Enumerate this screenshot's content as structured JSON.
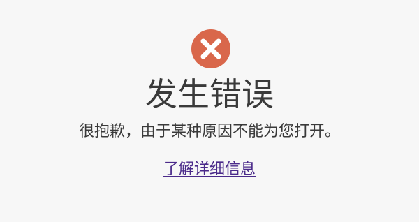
{
  "error": {
    "icon": "error-x-icon",
    "icon_color": "#d9674b",
    "title": "发生错误",
    "message": "很抱歉，由于某种原因不能为您打开。",
    "learn_more_label": "了解详细信息"
  }
}
